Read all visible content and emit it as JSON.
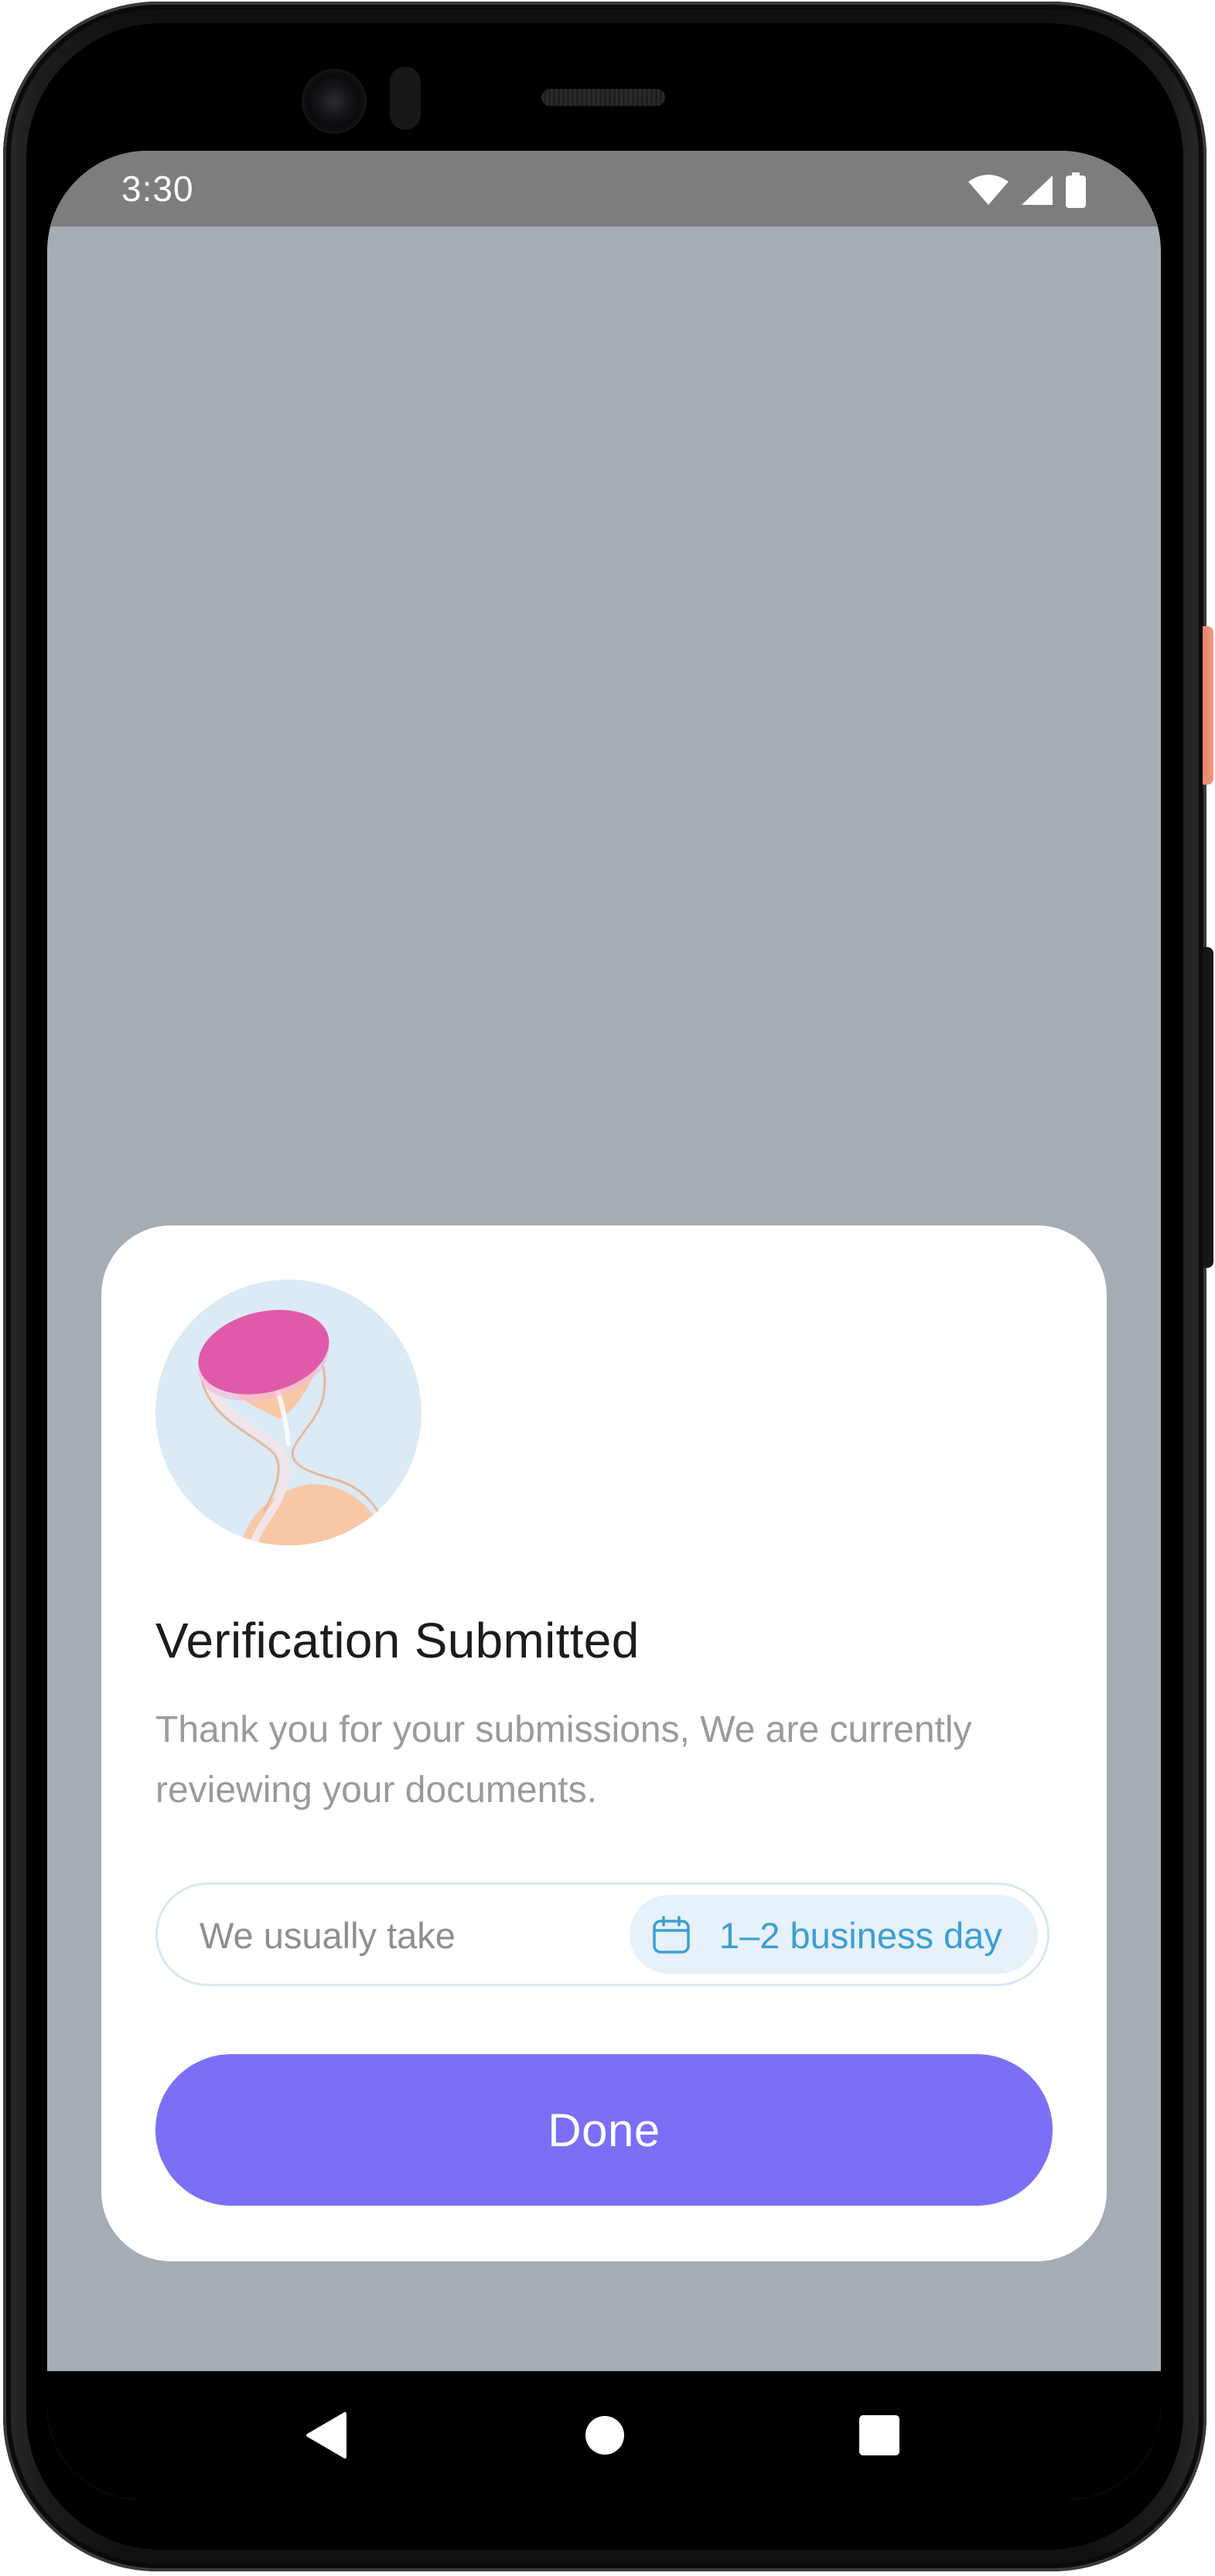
{
  "status_bar": {
    "time": "3:30",
    "icons": [
      "wifi-icon",
      "cellular-signal-icon",
      "battery-icon"
    ]
  },
  "sheet": {
    "illustration": "hourglass-illustration",
    "title": "Verification Submitted",
    "message": "Thank you for your submissions, We are currently reviewing your documents.",
    "duration_label": "We usually take",
    "duration_icon": "calendar-icon",
    "duration_value": "1–2 business day",
    "done_button": "Done"
  },
  "nav_bar": {
    "buttons": [
      "back-icon",
      "home-icon",
      "recents-icon"
    ]
  },
  "colors": {
    "scrim": "#a5acb3",
    "primary_button": "#7b6ff6",
    "badge_background": "#e6f1f9",
    "badge_text": "#3d9ed1",
    "hourglass_top": "#e05aaa",
    "illustration_background": "#dbeaf5",
    "sand": "#f8c7a8"
  }
}
